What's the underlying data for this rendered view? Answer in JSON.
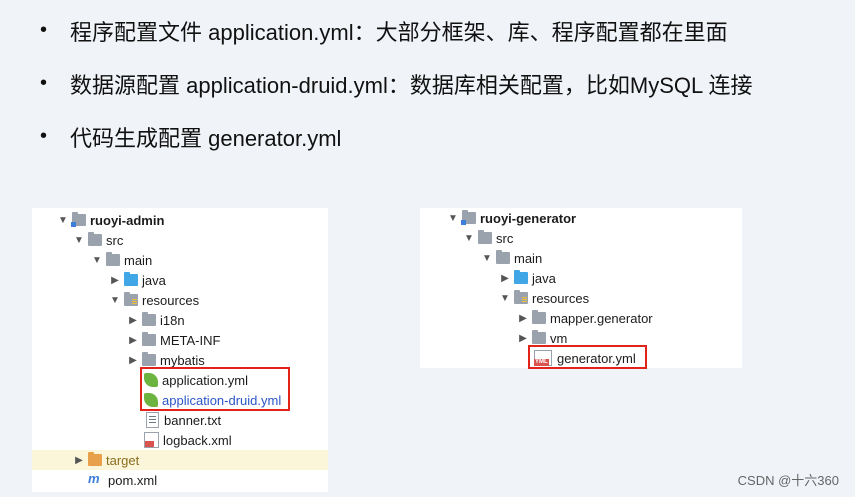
{
  "bullets": [
    "程序配置文件 application.yml：大部分框架、库、程序配置都在里面",
    "数据源配置 application-druid.yml：数据库相关配置，比如MySQL 连接",
    "代码生成配置 generator.yml"
  ],
  "bullet_marker": "•",
  "tree_admin": {
    "root": "ruoyi-admin",
    "src": "src",
    "main": "main",
    "java": "java",
    "resources": "resources",
    "i18n": "i18n",
    "meta_inf": "META-INF",
    "mybatis": "mybatis",
    "application_yml": "application.yml",
    "application_druid_yml": "application-druid.yml",
    "banner_txt": "banner.txt",
    "logback_xml": "logback.xml",
    "target": "target",
    "pom_xml": "pom.xml"
  },
  "tree_generator": {
    "root": "ruoyi-generator",
    "src": "src",
    "main": "main",
    "java": "java",
    "resources": "resources",
    "mapper_generator": "mapper.generator",
    "vm": "vm",
    "generator_yml": "generator.yml"
  },
  "icons": {
    "expanded": "chevron-down-icon",
    "collapsed": "chevron-right-icon",
    "pom": "m",
    "yml_badge": "YML"
  },
  "colors": {
    "highlight_box": "#e2231a",
    "selected_text": "#2b56c8",
    "spring_leaf": "#6db33f"
  },
  "watermark": "CSDN @十六360"
}
